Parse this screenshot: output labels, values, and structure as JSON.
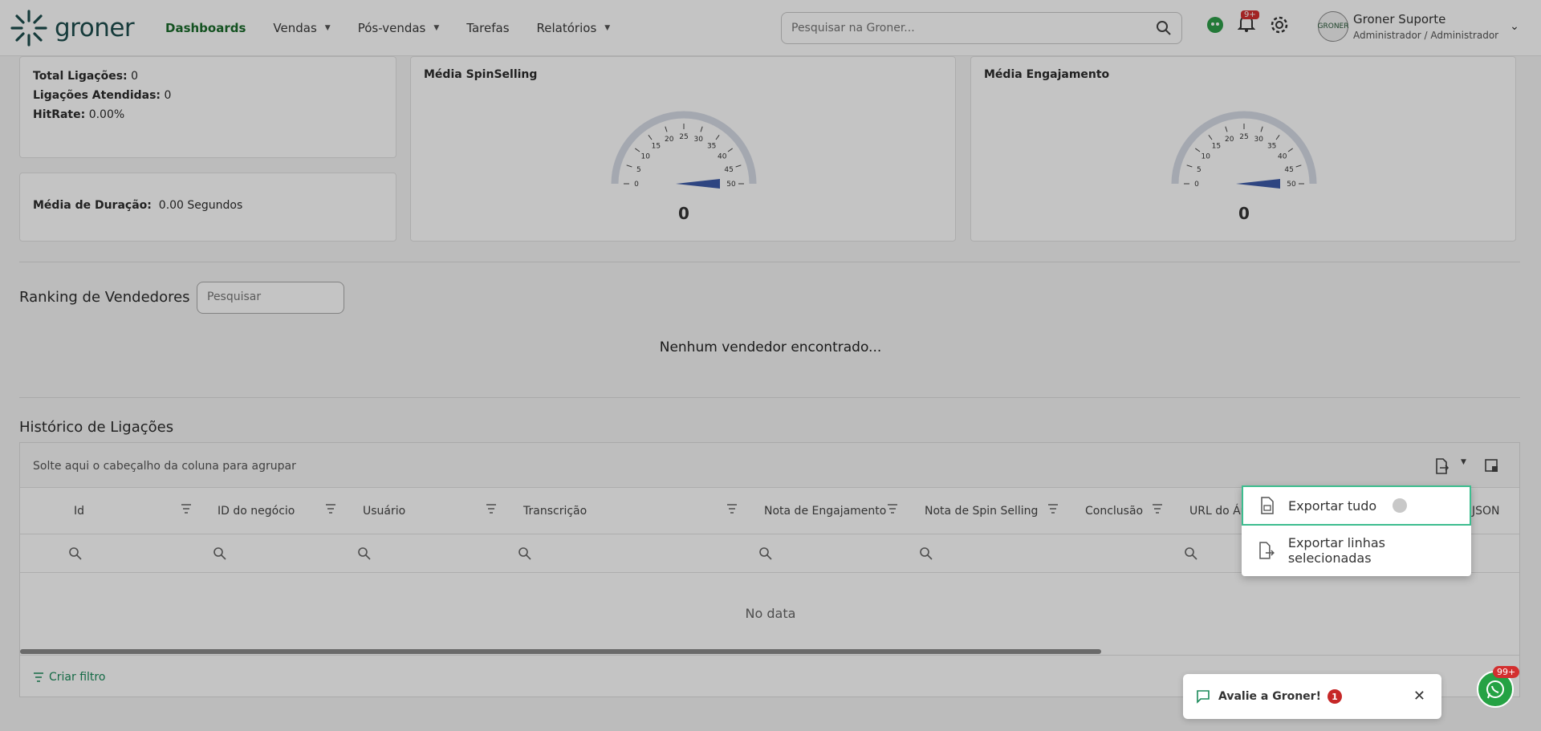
{
  "header": {
    "logo_text": "groner",
    "nav": [
      {
        "label": "Dashboards",
        "active": true,
        "has_caret": false
      },
      {
        "label": "Vendas",
        "active": false,
        "has_caret": true
      },
      {
        "label": "Pós-vendas",
        "active": false,
        "has_caret": true
      },
      {
        "label": "Tarefas",
        "active": false,
        "has_caret": false
      },
      {
        "label": "Relatórios",
        "active": false,
        "has_caret": true
      }
    ],
    "search_placeholder": "Pesquisar na Groner...",
    "notifications_badge": "9+",
    "user_name": "Groner Suporte",
    "user_role": "Administrador / Administrador",
    "avatar_text": "GRONER"
  },
  "stats": {
    "total_label": "Total Ligações:",
    "total_value": "0",
    "answered_label": "Ligações Atendidas:",
    "answered_value": "0",
    "hitrate_label": "HitRate:",
    "hitrate_value": "0.00%",
    "duration_label": "Média de Duração:",
    "duration_value": "0.00 Segundos"
  },
  "gauges": [
    {
      "title": "Média SpinSelling",
      "value": "0",
      "level": 0
    },
    {
      "title": "Média Engajamento",
      "value": "0",
      "level": 0
    }
  ],
  "gauge_ticks": [
    "0",
    "5",
    "10",
    "15",
    "20",
    "25",
    "30",
    "35",
    "40",
    "45",
    "50"
  ],
  "ranking": {
    "title": "Ranking de Vendedores",
    "search_placeholder": "Pesquisar",
    "empty_message": "Nenhum vendedor encontrado..."
  },
  "history": {
    "title": "Histórico de Ligações",
    "group_panel_text": "Solte aqui o cabeçalho da coluna para agrupar",
    "columns": [
      "Id",
      "ID do negócio",
      "Usuário",
      "Transcrição",
      "Nota de Engajamento",
      "Nota de Spin Selling",
      "Conclusão",
      "URL do Áu",
      "JSON"
    ],
    "no_data": "No data",
    "create_filter": "Criar filtro"
  },
  "export_menu": {
    "items": [
      "Exportar tudo",
      "Exportar linhas selecionadas"
    ]
  },
  "toast": {
    "text": "Avalie a Groner!",
    "count": "1"
  },
  "whatsapp_badge": "99+",
  "colors": {
    "brand_green": "#1b6b2c",
    "gauge_needle": "#3c5aa8",
    "focus_border": "#3dbd8f",
    "badge_red": "#d32f2f"
  }
}
